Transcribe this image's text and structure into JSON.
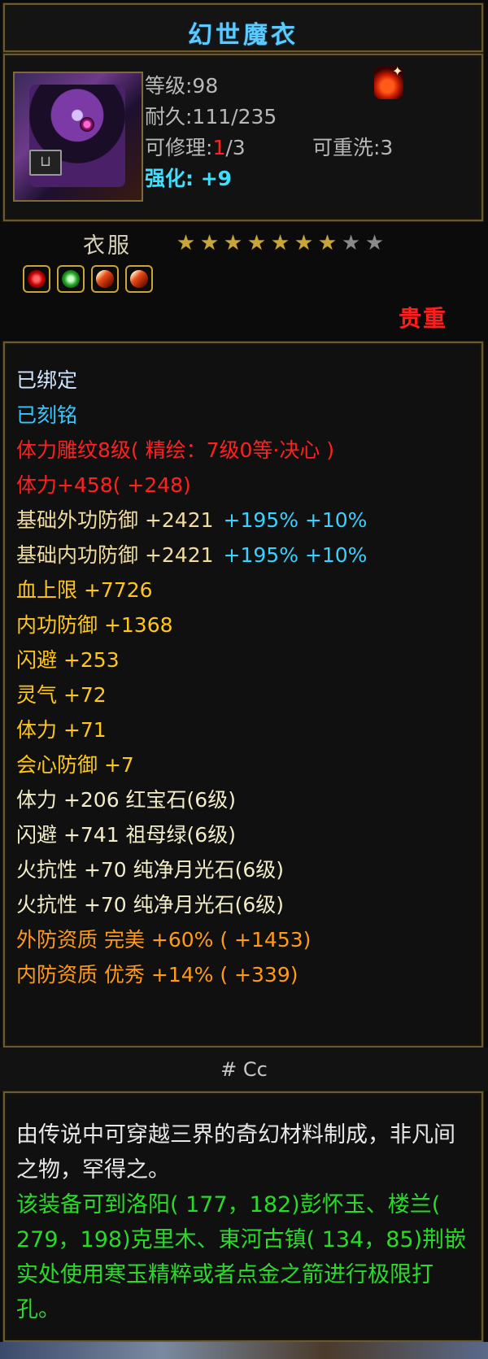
{
  "item": {
    "name": "幻世魔衣",
    "stats": {
      "level": "等级:98",
      "durability": "耐久:111/235",
      "repair_prefix": "可修理:",
      "repair_current": "1",
      "repair_suffix": "/3",
      "rewash": "可重洗:3",
      "enhance": "强化: +9"
    },
    "type": "衣服",
    "stars": {
      "filled": 7,
      "total": 9
    },
    "rarity": "贵重",
    "gem_icons": [
      "red-gem-icon",
      "green-gem-icon",
      "moonstone-icon",
      "moonstone-icon"
    ]
  },
  "attributes": [
    {
      "segments": [
        {
          "text": "已绑定",
          "color": "#cfe4ff"
        }
      ]
    },
    {
      "segments": [
        {
          "text": "已刻铭",
          "color": "#35c8ff"
        }
      ]
    },
    {
      "segments": [
        {
          "text": "体力雕纹8级( 精绘：7级0等·决心 )",
          "color": "#ff2020"
        }
      ]
    },
    {
      "segments": [
        {
          "text": "体力+458( +248)",
          "color": "#ff2020"
        }
      ]
    },
    {
      "segments": [
        {
          "text": "基础外功防御 +2421",
          "color": "#f0dca0"
        },
        {
          "text": "+195% +10%",
          "color": "#3ad0ff"
        }
      ]
    },
    {
      "segments": [
        {
          "text": "基础内功防御 +2421",
          "color": "#f0dca0"
        },
        {
          "text": "+195% +10%",
          "color": "#3ad0ff"
        }
      ]
    },
    {
      "segments": [
        {
          "text": "血上限 +7726",
          "color": "#ffc61e"
        }
      ]
    },
    {
      "segments": [
        {
          "text": "内功防御 +1368",
          "color": "#ffc61e"
        }
      ]
    },
    {
      "segments": [
        {
          "text": "闪避 +253",
          "color": "#ffc61e"
        }
      ]
    },
    {
      "segments": [
        {
          "text": "灵气 +72",
          "color": "#ffc61e"
        }
      ]
    },
    {
      "segments": [
        {
          "text": "体力 +71",
          "color": "#ffc61e"
        }
      ]
    },
    {
      "segments": [
        {
          "text": "会心防御 +7",
          "color": "#ffc61e"
        }
      ]
    },
    {
      "segments": [
        {
          "text": "体力 +206 红宝石(6级)",
          "color": "#f2ecc8"
        }
      ]
    },
    {
      "segments": [
        {
          "text": "闪避 +741 祖母绿(6级)",
          "color": "#f2ecc8"
        }
      ]
    },
    {
      "segments": [
        {
          "text": "火抗性 +70 纯净月光石(6级)",
          "color": "#f2ecc8"
        }
      ]
    },
    {
      "segments": [
        {
          "text": "火抗性 +70 纯净月光石(6级)",
          "color": "#f2ecc8"
        }
      ]
    },
    {
      "segments": [
        {
          "text": "外防资质  完美 +60% ( +1453)",
          "color": "#ff9a1a"
        }
      ]
    },
    {
      "segments": [
        {
          "text": "内防资质  优秀 +14% ( +339)",
          "color": "#ff9a1a"
        }
      ]
    }
  ],
  "code_label": "# Cc",
  "description": {
    "lore": "由传说中可穿越三界的奇幻材料制成，非凡间之物，罕得之。",
    "tip": "该装备可到洛阳( 177，182)彭怀玉、楼兰( 279，198)克里木、東河古镇( 134，85)荆嵌实处使用寒玉精粹或者点金之箭进行极限打孔。"
  }
}
